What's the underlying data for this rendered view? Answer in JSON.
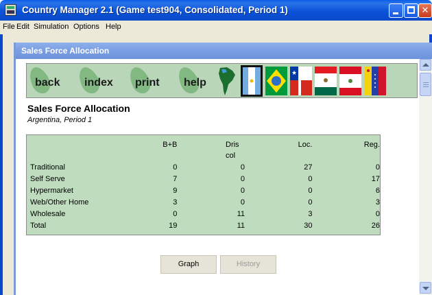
{
  "window": {
    "title": "Country Manager 2.1 (Game test904, Consolidated, Period 1)"
  },
  "menubar": {
    "items": [
      "File",
      "Edit",
      "Simulation",
      "Options",
      "Help"
    ]
  },
  "child_window": {
    "title": "Sales Force Allocation"
  },
  "toolbar": {
    "nav": [
      "back",
      "index",
      "print",
      "help"
    ],
    "flags": [
      "south-america-map-icon",
      "argentina-flag-icon",
      "brazil-flag-icon",
      "chile-flag-icon",
      "mexico-flag-icon",
      "peru-flag-icon",
      "venezuela-flag-icon"
    ]
  },
  "page": {
    "heading": "Sales Force Allocation",
    "subheading": "Argentina, Period 1"
  },
  "table": {
    "columns": [
      "B+B",
      "Dris col",
      "Loc.",
      "Reg."
    ],
    "rows": [
      {
        "label": "Traditional",
        "values": [
          "0",
          "0",
          "27",
          "0"
        ]
      },
      {
        "label": "Self Serve",
        "values": [
          "7",
          "0",
          "0",
          "17"
        ]
      },
      {
        "label": "Hypermarket",
        "values": [
          "9",
          "0",
          "0",
          "6"
        ]
      },
      {
        "label": "Web/Other Home",
        "values": [
          "3",
          "0",
          "0",
          "3"
        ]
      },
      {
        "label": "Wholesale",
        "values": [
          "0",
          "11",
          "3",
          "0"
        ]
      },
      {
        "label": "Total",
        "values": [
          "19",
          "11",
          "30",
          "26"
        ]
      }
    ]
  },
  "buttons": {
    "graph": "Graph",
    "history": "History"
  },
  "colors": {
    "titlebar": "#0a53d8",
    "panel_green": "#bfdcbf",
    "child_title": "#7a9ee3"
  }
}
